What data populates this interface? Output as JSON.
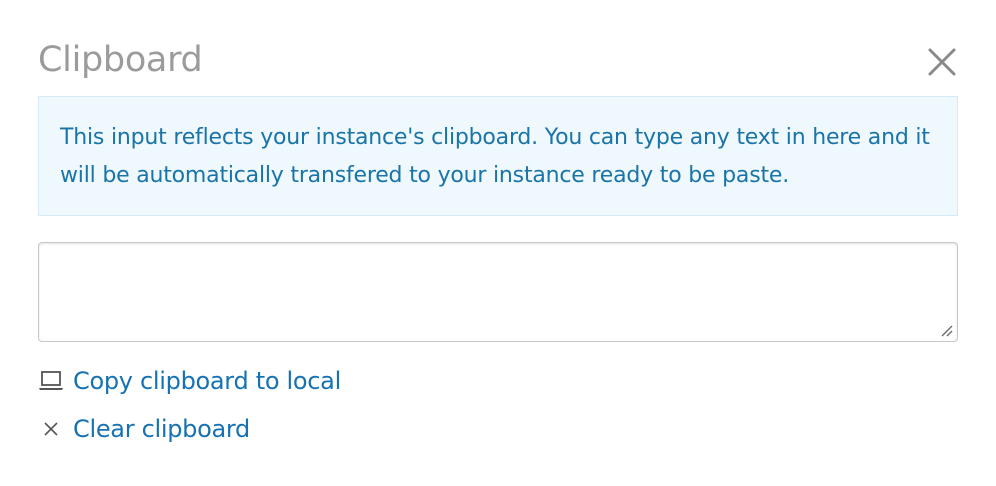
{
  "dialog": {
    "title": "Clipboard",
    "close_icon": "close-icon"
  },
  "info": {
    "text": "This input reflects your instance's clipboard. You can type any text in here and it will be automatically transfered to your instance ready to be paste."
  },
  "clipboard_input": {
    "value": "",
    "placeholder": ""
  },
  "actions": {
    "copy_label": "Copy clipboard to local",
    "copy_icon": "laptop-icon",
    "clear_label": "Clear clipboard",
    "clear_icon": "clear-x-icon"
  },
  "colors": {
    "title": "#9b9b9b",
    "info_background": "#eef8fd",
    "info_border": "#d4ecf7",
    "info_text": "#1a74a8",
    "link": "#1772b3",
    "icon": "#555555"
  }
}
